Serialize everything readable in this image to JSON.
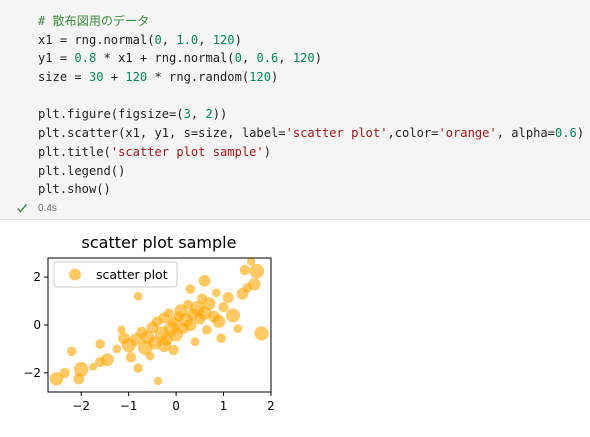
{
  "code": {
    "lines": [
      [
        {
          "t": "# 散布図用のデータ",
          "c": "c-comment"
        }
      ],
      [
        {
          "t": "x1 = rng.normal("
        },
        {
          "t": "0",
          "c": "c-num"
        },
        {
          "t": ", "
        },
        {
          "t": "1.0",
          "c": "c-num"
        },
        {
          "t": ", "
        },
        {
          "t": "120",
          "c": "c-num"
        },
        {
          "t": ")"
        }
      ],
      [
        {
          "t": "y1 = "
        },
        {
          "t": "0.8",
          "c": "c-num"
        },
        {
          "t": " * x1 + rng.normal("
        },
        {
          "t": "0",
          "c": "c-num"
        },
        {
          "t": ", "
        },
        {
          "t": "0.6",
          "c": "c-num"
        },
        {
          "t": ", "
        },
        {
          "t": "120",
          "c": "c-num"
        },
        {
          "t": ")"
        }
      ],
      [
        {
          "t": "size = "
        },
        {
          "t": "30",
          "c": "c-num"
        },
        {
          "t": " + "
        },
        {
          "t": "120",
          "c": "c-num"
        },
        {
          "t": " * rng.random("
        },
        {
          "t": "120",
          "c": "c-num"
        },
        {
          "t": ")"
        }
      ],
      [
        {
          "t": ""
        }
      ],
      [
        {
          "t": "plt.figure(figsize=("
        },
        {
          "t": "3",
          "c": "c-num"
        },
        {
          "t": ", "
        },
        {
          "t": "2",
          "c": "c-num"
        },
        {
          "t": "))"
        }
      ],
      [
        {
          "t": "plt.scatter(x1, y1, s=size, label="
        },
        {
          "t": "'scatter plot'",
          "c": "c-str"
        },
        {
          "t": ",color="
        },
        {
          "t": "'orange'",
          "c": "c-str"
        },
        {
          "t": ", alpha="
        },
        {
          "t": "0.6",
          "c": "c-num"
        },
        {
          "t": ")"
        }
      ],
      [
        {
          "t": "plt.title("
        },
        {
          "t": "'scatter plot sample'",
          "c": "c-str"
        },
        {
          "t": ")"
        }
      ],
      [
        {
          "t": "plt.legend()"
        }
      ],
      [
        {
          "t": "plt.show()"
        }
      ]
    ]
  },
  "execution": {
    "status_icon": "check-icon",
    "time": "0.4s",
    "check_color": "#3f8a3f"
  },
  "chart_data": {
    "type": "scatter",
    "title": "scatter plot sample",
    "xlabel": "",
    "ylabel": "",
    "xlim": [
      -2.7,
      2.0
    ],
    "ylim": [
      -2.8,
      2.8
    ],
    "xticks": [
      -2,
      -1,
      0,
      1,
      2
    ],
    "xtick_labels": [
      "−2",
      "−1",
      "0",
      "1",
      "2"
    ],
    "yticks": [
      -2,
      0,
      2
    ],
    "ytick_labels": [
      "−2",
      "0",
      "2"
    ],
    "grid": false,
    "legend": {
      "placement": "top-left",
      "label": "scatter plot"
    },
    "color": "#ffa500",
    "alpha": 0.6,
    "series": [
      {
        "name": "scatter plot",
        "points": [
          {
            "x": -2.52,
            "y": -2.25,
            "s": 120
          },
          {
            "x": -2.35,
            "y": -2.0,
            "s": 70
          },
          {
            "x": -2.2,
            "y": -1.1,
            "s": 60
          },
          {
            "x": -2.05,
            "y": -2.25,
            "s": 80
          },
          {
            "x": -2.0,
            "y": -1.85,
            "s": 140
          },
          {
            "x": -1.75,
            "y": -1.75,
            "s": 40
          },
          {
            "x": -1.6,
            "y": -1.55,
            "s": 70
          },
          {
            "x": -1.45,
            "y": -1.45,
            "s": 110
          },
          {
            "x": -1.6,
            "y": -0.8,
            "s": 60
          },
          {
            "x": -1.25,
            "y": -1.0,
            "s": 50
          },
          {
            "x": -1.1,
            "y": -0.55,
            "s": 90
          },
          {
            "x": -1.0,
            "y": -0.85,
            "s": 130
          },
          {
            "x": -0.95,
            "y": -1.35,
            "s": 70
          },
          {
            "x": -0.85,
            "y": -0.6,
            "s": 100
          },
          {
            "x": -0.8,
            "y": -1.8,
            "s": 60
          },
          {
            "x": -0.72,
            "y": -0.3,
            "s": 80
          },
          {
            "x": -0.65,
            "y": -0.95,
            "s": 140
          },
          {
            "x": -0.6,
            "y": -0.5,
            "s": 120
          },
          {
            "x": -0.55,
            "y": -1.3,
            "s": 50
          },
          {
            "x": -0.5,
            "y": -0.1,
            "s": 90
          },
          {
            "x": -0.45,
            "y": -0.75,
            "s": 110
          },
          {
            "x": -0.4,
            "y": 0.15,
            "s": 70
          },
          {
            "x": -0.38,
            "y": -2.35,
            "s": 45
          },
          {
            "x": -0.3,
            "y": -0.35,
            "s": 130
          },
          {
            "x": -0.25,
            "y": 0.3,
            "s": 80
          },
          {
            "x": -0.2,
            "y": -0.6,
            "s": 100
          },
          {
            "x": -0.15,
            "y": 0.5,
            "s": 60
          },
          {
            "x": -0.1,
            "y": -0.15,
            "s": 140
          },
          {
            "x": -0.05,
            "y": 0.1,
            "s": 90
          },
          {
            "x": 0.0,
            "y": -0.4,
            "s": 120
          },
          {
            "x": 0.05,
            "y": 0.35,
            "s": 70
          },
          {
            "x": 0.1,
            "y": 0.6,
            "s": 110
          },
          {
            "x": 0.15,
            "y": -0.15,
            "s": 80
          },
          {
            "x": 0.2,
            "y": 0.2,
            "s": 130
          },
          {
            "x": 0.25,
            "y": 0.85,
            "s": 60
          },
          {
            "x": 0.3,
            "y": 0.0,
            "s": 100
          },
          {
            "x": 0.35,
            "y": 0.45,
            "s": 90
          },
          {
            "x": 0.4,
            "y": -0.7,
            "s": 50
          },
          {
            "x": 0.45,
            "y": 0.7,
            "s": 140
          },
          {
            "x": 0.5,
            "y": 0.25,
            "s": 80
          },
          {
            "x": 0.55,
            "y": 1.1,
            "s": 70
          },
          {
            "x": 0.6,
            "y": 0.5,
            "s": 120
          },
          {
            "x": 0.65,
            "y": -0.2,
            "s": 60
          },
          {
            "x": 0.7,
            "y": 0.9,
            "s": 100
          },
          {
            "x": 0.8,
            "y": 0.35,
            "s": 90
          },
          {
            "x": 0.85,
            "y": 1.35,
            "s": 50
          },
          {
            "x": 0.9,
            "y": 0.15,
            "s": 110
          },
          {
            "x": 1.0,
            "y": 0.75,
            "s": 70
          },
          {
            "x": 1.1,
            "y": 1.15,
            "s": 80
          },
          {
            "x": 1.2,
            "y": 0.4,
            "s": 130
          },
          {
            "x": 1.3,
            "y": -0.15,
            "s": 50
          },
          {
            "x": 1.4,
            "y": 1.3,
            "s": 90
          },
          {
            "x": 1.45,
            "y": 2.3,
            "s": 70
          },
          {
            "x": 1.5,
            "y": 1.55,
            "s": 60
          },
          {
            "x": 1.58,
            "y": 2.65,
            "s": 45
          },
          {
            "x": 1.65,
            "y": 1.7,
            "s": 100
          },
          {
            "x": 1.7,
            "y": 2.25,
            "s": 140
          },
          {
            "x": 1.8,
            "y": -0.35,
            "s": 130
          },
          {
            "x": -0.05,
            "y": -1.05,
            "s": 70
          },
          {
            "x": -0.8,
            "y": 1.2,
            "s": 50
          },
          {
            "x": 0.6,
            "y": 1.85,
            "s": 90
          },
          {
            "x": 0.3,
            "y": 1.5,
            "s": 60
          },
          {
            "x": -0.25,
            "y": -0.85,
            "s": 120
          },
          {
            "x": -1.15,
            "y": -0.2,
            "s": 45
          },
          {
            "x": 0.95,
            "y": -0.55,
            "s": 60
          }
        ]
      }
    ]
  }
}
